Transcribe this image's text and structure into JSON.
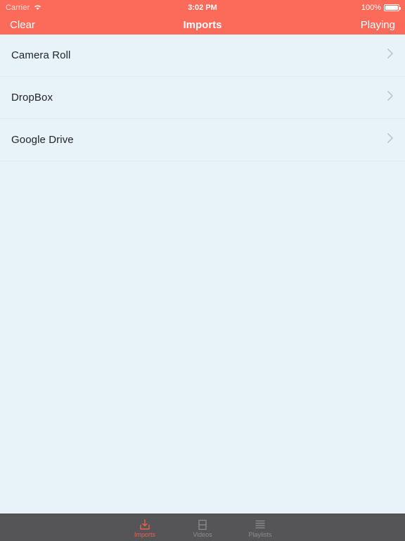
{
  "theme": {
    "accent": "#fc6a5a",
    "background": "#e8f2f9",
    "tabbar_bg": "#555558",
    "tab_active": "#e8604f",
    "tab_inactive": "#8d8d90",
    "text": "#21252b",
    "separator": "#dde9f2",
    "chevron": "#b9c6d2"
  },
  "status_bar": {
    "carrier": "Carrier",
    "wifi_icon": "wifi-icon",
    "time": "3:02 PM",
    "battery_percent": "100%",
    "battery_icon": "battery-full-icon"
  },
  "nav_bar": {
    "left_button": "Clear",
    "title": "Imports",
    "right_button": "Playing"
  },
  "list": {
    "rows": [
      {
        "label": "Camera Roll",
        "accessory_icon": "chevron-right-icon"
      },
      {
        "label": "DropBox",
        "accessory_icon": "chevron-right-icon"
      },
      {
        "label": "Google Drive",
        "accessory_icon": "chevron-right-icon"
      }
    ]
  },
  "tab_bar": {
    "tabs": [
      {
        "label": "Imports",
        "icon": "import-download-icon",
        "active": true
      },
      {
        "label": "Videos",
        "icon": "video-frame-icon",
        "active": false
      },
      {
        "label": "Playlists",
        "icon": "list-lines-icon",
        "active": false
      }
    ]
  }
}
